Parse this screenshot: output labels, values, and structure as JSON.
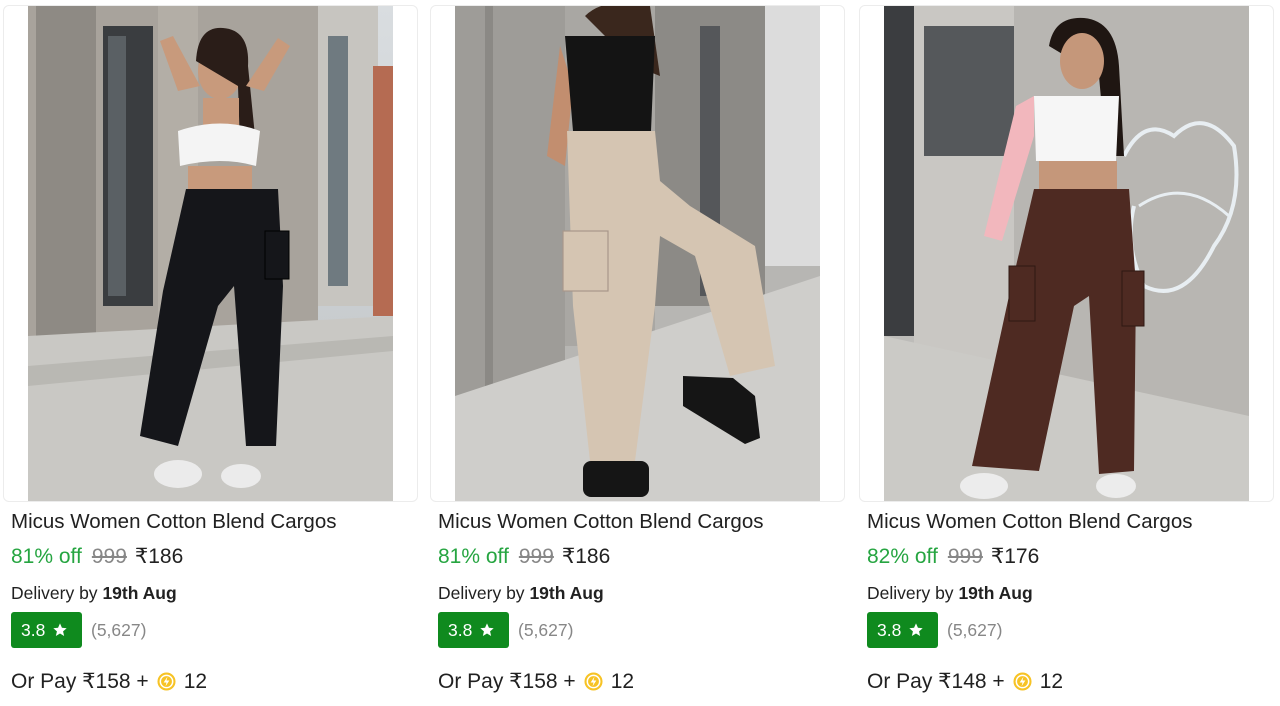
{
  "products": [
    {
      "title": "Micus Women Cotton Blend Cargos",
      "discount": "81% off",
      "mrp": "999",
      "price": "₹186",
      "delivery_prefix": "Delivery by",
      "delivery_date": "19th Aug",
      "rating": "3.8",
      "review_count": "(5,627)",
      "pay_prefix": "Or Pay ₹158 +",
      "coins": "12",
      "image_icon": "product-photo-black-cargos",
      "pant_color": "#15161a"
    },
    {
      "title": "Micus Women Cotton Blend Cargos",
      "discount": "81% off",
      "mrp": "999",
      "price": "₹186",
      "delivery_prefix": "Delivery by",
      "delivery_date": "19th Aug",
      "rating": "3.8",
      "review_count": "(5,627)",
      "pay_prefix": "Or Pay ₹158 +",
      "coins": "12",
      "image_icon": "product-photo-beige-cargos",
      "pant_color": "#d5c5b2"
    },
    {
      "title": "Micus Women Cotton Blend Cargos",
      "discount": "82% off",
      "mrp": "999",
      "price": "₹176",
      "delivery_prefix": "Delivery by",
      "delivery_date": "19th Aug",
      "rating": "3.8",
      "review_count": "(5,627)",
      "pay_prefix": "Or Pay ₹148 +",
      "coins": "12",
      "image_icon": "product-photo-brown-cargos",
      "pant_color": "#4e2a22"
    }
  ],
  "colors": {
    "discount_green": "#26a541",
    "rating_green": "#0f8a1e",
    "muted_grey": "#878787",
    "coin_gold": "#f7c325"
  }
}
